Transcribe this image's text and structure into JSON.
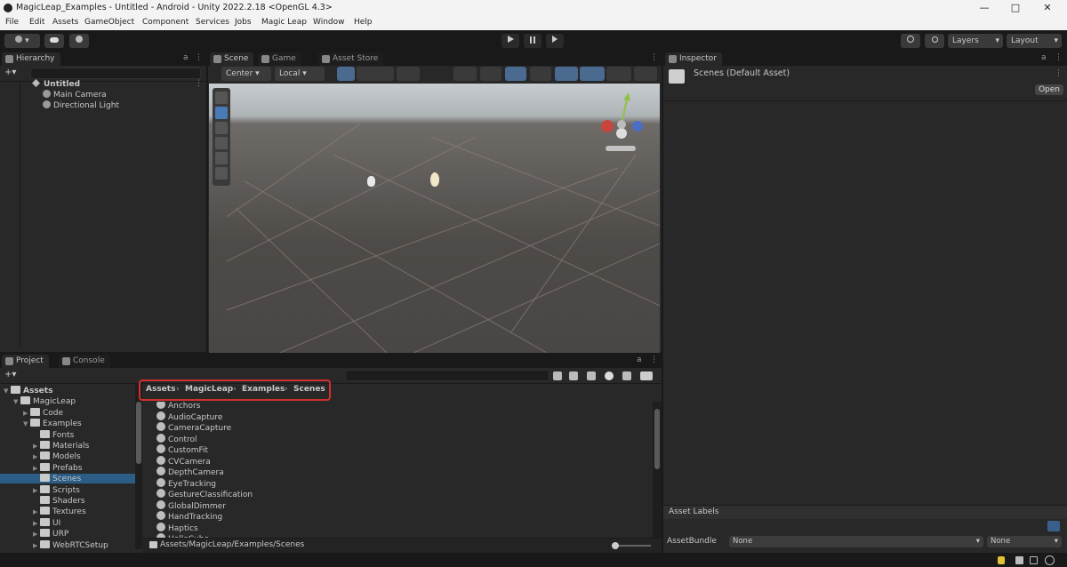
{
  "titlebar": {
    "title": "MagicLeap_Examples - Untitled - Android - Unity 2022.2.18 <OpenGL 4.3>",
    "minimize": "—",
    "maximize": "□",
    "close": "✕"
  },
  "menu": [
    "File",
    "Edit",
    "Assets",
    "GameObject",
    "Component",
    "Services",
    "Jobs",
    "Magic Leap",
    "Window",
    "Help"
  ],
  "toolbar": {
    "account_label": "▾",
    "layers_label": "Layers",
    "layout_label": "Layout"
  },
  "hierarchy": {
    "tab": "Hierarchy",
    "add_label": "+▾",
    "scene": "Untitled",
    "items": [
      "Main Camera",
      "Directional Light"
    ]
  },
  "scene": {
    "tabs": [
      "Scene",
      "Game",
      "Asset Store"
    ],
    "shading_label": "Center",
    "pivot_label": "Local"
  },
  "inspector": {
    "tab": "Inspector",
    "asset_name": "Scenes (Default Asset)",
    "open_label": "Open",
    "asset_labels": "Asset Labels",
    "assetbundle_label": "AssetBundle",
    "assetbundle_value": "None",
    "variant_value": "None"
  },
  "project": {
    "tabs": [
      "Project",
      "Console"
    ],
    "add_label": "+▾",
    "tree": [
      {
        "label": "Assets",
        "depth": 0,
        "arrow": "▼"
      },
      {
        "label": "MagicLeap",
        "depth": 1,
        "arrow": "▼"
      },
      {
        "label": "Code",
        "depth": 2,
        "arrow": "▶"
      },
      {
        "label": "Examples",
        "depth": 2,
        "arrow": "▼"
      },
      {
        "label": "Fonts",
        "depth": 3,
        "arrow": ""
      },
      {
        "label": "Materials",
        "depth": 3,
        "arrow": "▶"
      },
      {
        "label": "Models",
        "depth": 3,
        "arrow": "▶"
      },
      {
        "label": "Prefabs",
        "depth": 3,
        "arrow": "▶"
      },
      {
        "label": "Scenes",
        "depth": 3,
        "arrow": "",
        "selected": true
      },
      {
        "label": "Scripts",
        "depth": 3,
        "arrow": "▶"
      },
      {
        "label": "Shaders",
        "depth": 3,
        "arrow": ""
      },
      {
        "label": "Textures",
        "depth": 3,
        "arrow": "▶"
      },
      {
        "label": "UI",
        "depth": 3,
        "arrow": "▶"
      },
      {
        "label": "URP",
        "depth": 3,
        "arrow": "▶"
      },
      {
        "label": "WebRTCSetup",
        "depth": 3,
        "arrow": "▶"
      }
    ],
    "breadcrumb": [
      "Assets",
      "MagicLeap",
      "Examples",
      "Scenes"
    ],
    "files": [
      "Anchors",
      "AudioCapture",
      "CameraCapture",
      "Control",
      "CustomFit",
      "CVCamera",
      "DepthCamera",
      "EyeTracking",
      "GestureClassification",
      "GlobalDimmer",
      "HandTracking",
      "Haptics",
      "HelloCube"
    ],
    "path": "Assets/MagicLeap/Examples/Scenes"
  },
  "colors": {
    "highlight": "#d32f2f",
    "selection": "#2c5d87",
    "accent_blue": "#4a7bb7"
  }
}
